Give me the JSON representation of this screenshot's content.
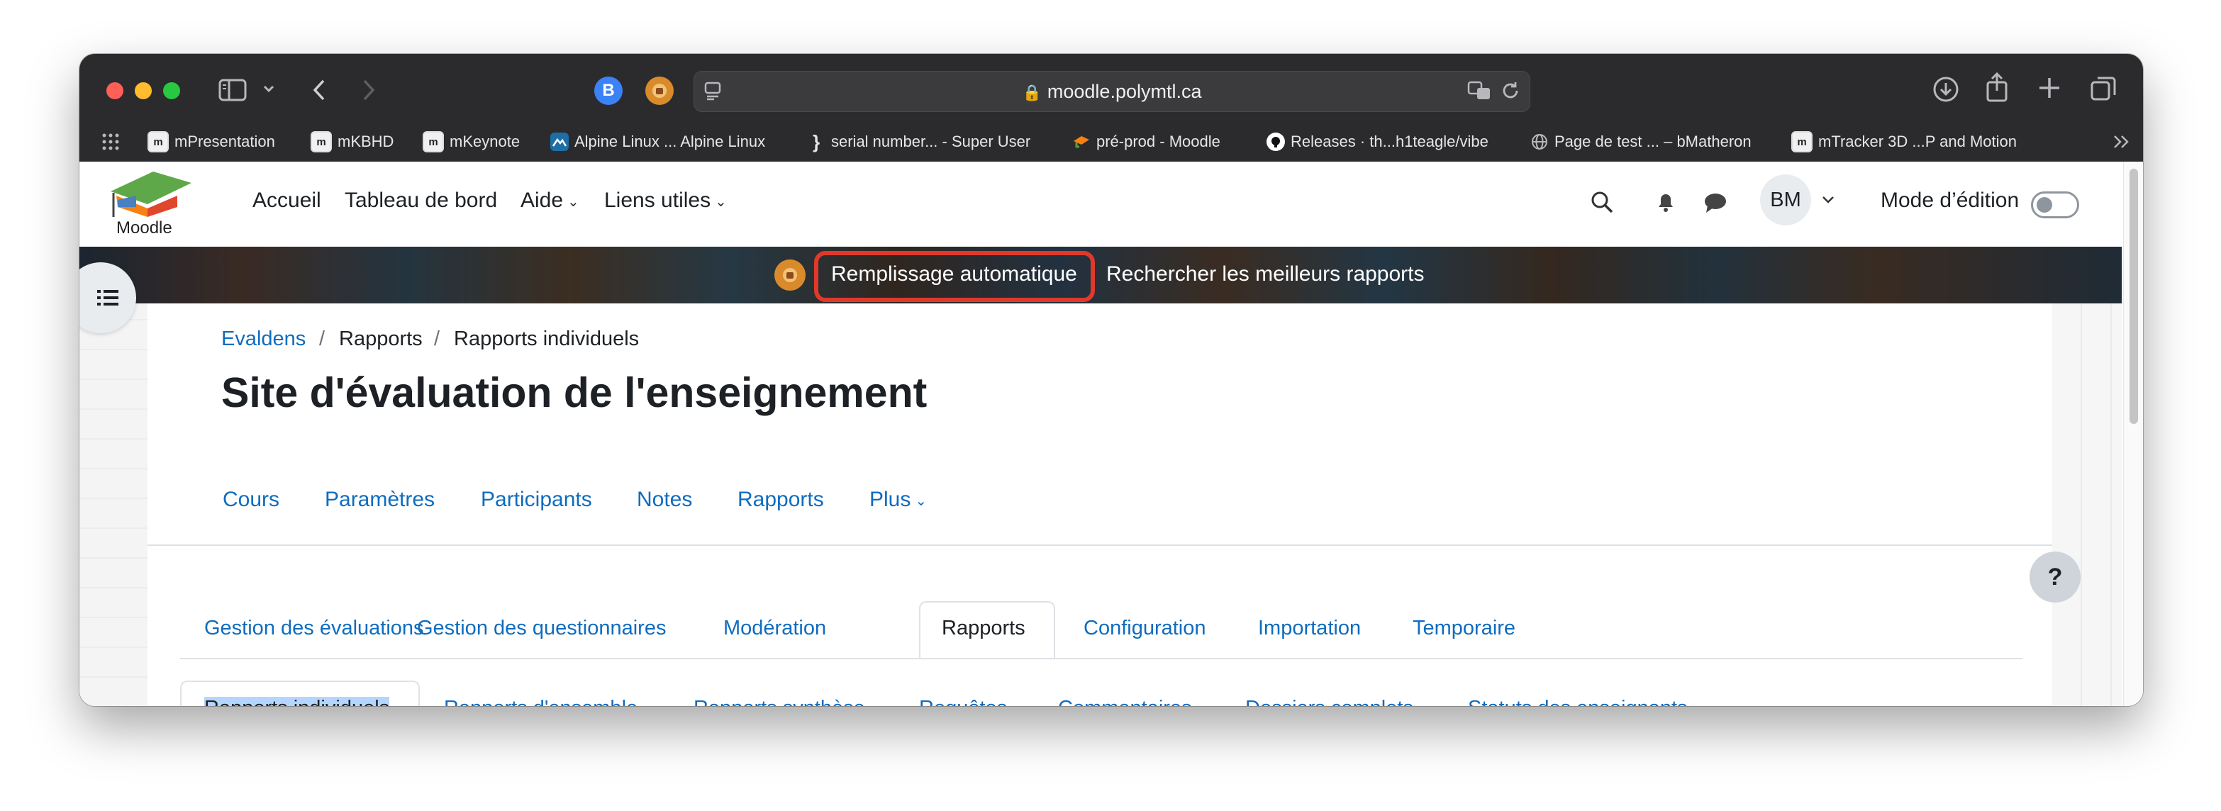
{
  "browser": {
    "url": "moodle.polymtl.ca",
    "tab_badge_b": "B",
    "bookmarks": [
      {
        "label": "mPresentation",
        "icon": "moodle-m-icon"
      },
      {
        "label": "mKBHD",
        "icon": "moodle-m-icon"
      },
      {
        "label": "mKeynote",
        "icon": "moodle-m-icon"
      },
      {
        "label": "Alpine Linux ... Alpine Linux",
        "icon": "alpine-icon"
      },
      {
        "label": "serial number... - Super User",
        "icon": "superuser-icon"
      },
      {
        "label": "pré-prod - Moodle",
        "icon": "moodle-hat-icon"
      },
      {
        "label": "Releases · th...h1teagle/vibe",
        "icon": "github-icon"
      },
      {
        "label": "Page de test ... – bMatheron",
        "icon": "globe-icon"
      },
      {
        "label": "mTracker 3D ...P and Motion",
        "icon": "moodle-m-icon"
      }
    ]
  },
  "moodle": {
    "logo_text": "Moodle",
    "nav": {
      "accueil": "Accueil",
      "tableau": "Tableau de bord",
      "aide": "Aide",
      "liens": "Liens utiles"
    },
    "user_initials": "BM",
    "edit_mode_label": "Mode d’édition"
  },
  "banner": {
    "autofill": "Remplissage automatique",
    "search_reports": "Rechercher les meilleurs rapports"
  },
  "breadcrumb": {
    "items": [
      "Evaldens",
      "Rapports",
      "Rapports individuels"
    ],
    "separator": "/"
  },
  "page_title": "Site d'évaluation de l'enseignement",
  "course_nav": [
    "Cours",
    "Paramètres",
    "Participants",
    "Notes",
    "Rapports",
    "Plus"
  ],
  "tabs_primary": [
    "Gestion des évaluations",
    "Gestion des questionnaires",
    "Modération",
    "Rapports",
    "Configuration",
    "Importation",
    "Temporaire"
  ],
  "tabs_secondary": [
    "Rapports individuels",
    "Rapports d'ensemble",
    "Rapports synthèse",
    "Requêtes",
    "Commentaires",
    "Dossiers complets",
    "Statuts des enseignants"
  ],
  "help_label": "?",
  "colors": {
    "link": "#0f6cbf",
    "highlight_border": "#e0392c",
    "selected_text_bg": "#b4d5fe"
  }
}
